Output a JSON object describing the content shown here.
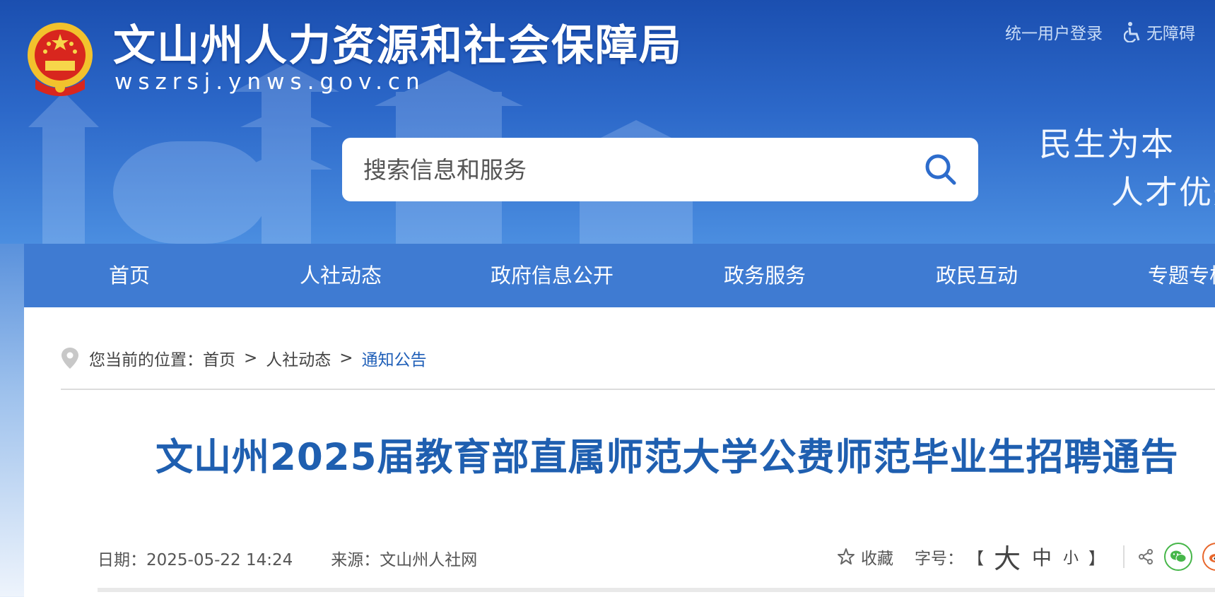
{
  "header": {
    "site_title": "文山州人力资源和社会保障局",
    "site_domain": "wszrsj.ynws.gov.cn",
    "login_label": "统一用户登录",
    "accessibility_label": "无障碍",
    "slogan_line1": "民生为本",
    "slogan_line2": "人才优先"
  },
  "search": {
    "placeholder": "搜索信息和服务"
  },
  "nav": {
    "items": [
      {
        "label": "首页"
      },
      {
        "label": "人社动态"
      },
      {
        "label": "政府信息公开"
      },
      {
        "label": "政务服务"
      },
      {
        "label": "政民互动"
      },
      {
        "label": "专题专栏"
      }
    ]
  },
  "breadcrumb": {
    "prefix": "您当前的位置：",
    "items": [
      "首页",
      "人社动态",
      "通知公告"
    ],
    "separator": ">"
  },
  "article": {
    "title": "文山州2025届教育部直属师范大学公费师范毕业生招聘通告",
    "date_label": "日期：2025-05-22 14:24",
    "source_label": "来源：文山州人社网"
  },
  "tools": {
    "favorite_label": "收藏",
    "font_size_label": "字号：",
    "bracket_open": "【",
    "bracket_close": "】",
    "size_large": "大",
    "size_medium": "中",
    "size_small": "小"
  },
  "colors": {
    "header_blue": "#2c68c9",
    "nav_blue": "#3f7bd2",
    "title_blue": "#1f5fb0",
    "wechat_green": "#46b649",
    "weibo_orange": "#e8672c"
  },
  "icons": {
    "emblem": "national-emblem",
    "accessibility": "wheelchair-icon",
    "search": "search-icon",
    "location": "location-pin-icon",
    "favorite": "star-icon",
    "share": "share-icon",
    "wechat": "wechat-icon",
    "weibo": "weibo-icon"
  }
}
